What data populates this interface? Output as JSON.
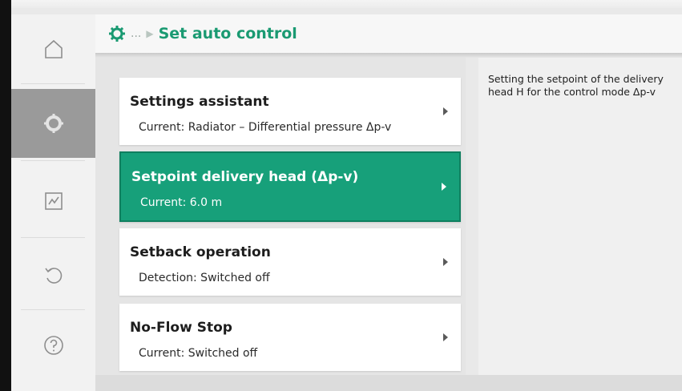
{
  "header": {
    "gear_icon": "gear-icon",
    "breadcrumb_ellipsis": "...",
    "title": "Set auto control"
  },
  "nav": {
    "items": [
      {
        "icon": "home-icon",
        "active": false
      },
      {
        "icon": "gear-icon",
        "active": true
      },
      {
        "icon": "diagnostics-icon",
        "active": false
      },
      {
        "icon": "restore-icon",
        "active": false
      },
      {
        "icon": "help-icon",
        "active": false
      }
    ]
  },
  "menu": {
    "items": [
      {
        "title": "Settings assistant",
        "subtitle": "Current: Radiator – Differential pressure Δp-v",
        "selected": false
      },
      {
        "title": "Setpoint delivery head (Δp-v)",
        "subtitle": "Current: 6.0 m",
        "selected": true
      },
      {
        "title": "Setback operation",
        "subtitle": "Detection: Switched off",
        "selected": false
      },
      {
        "title": "No-Flow Stop",
        "subtitle": "Current: Switched off",
        "selected": false
      }
    ]
  },
  "info": {
    "text": "Setting the setpoint of the delivery head H for the control mode Δp-v"
  },
  "colors": {
    "accent": "#17a07a",
    "header_title": "#1a9a72",
    "nav_active": "#9a9a9a"
  }
}
